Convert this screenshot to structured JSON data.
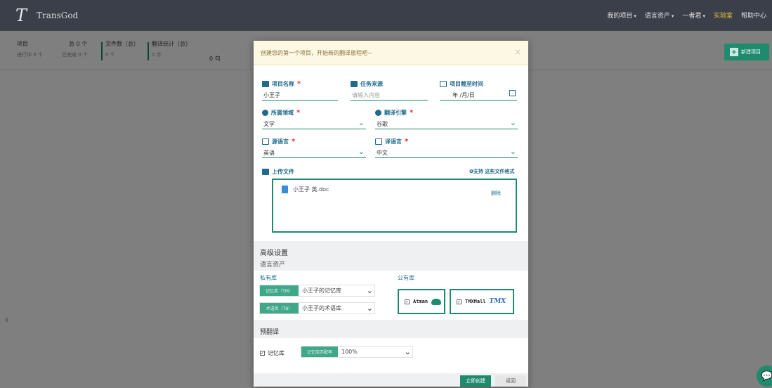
{
  "navbar": {
    "logo_glyph": "T",
    "brand": "TransGod",
    "menu": [
      "我的项目",
      "语言资产",
      "一者君",
      "实验室",
      "帮助中心"
    ]
  },
  "stats": {
    "project_label": "项目",
    "total": "总 0 个",
    "in_progress": "进行中 0 个",
    "completed": "已完成 0 个",
    "files_label": "文件数（总）",
    "files_sub": "0 个",
    "translation_label": "翻译统计（总）",
    "translation_sub": "0 字",
    "translation_val": "0 句",
    "new_project": "新建项目"
  },
  "modal": {
    "title": "创建您的第一个项目，开始新的翻译旅程吧~",
    "close": "×",
    "project_name": {
      "label": "项目名称",
      "value": "小王子"
    },
    "task_source": {
      "label": "任务来源",
      "placeholder": "请输入内容"
    },
    "deadline": {
      "label": "项目截至时间",
      "value": "年 /月/日"
    },
    "domain": {
      "label": "所属领域",
      "value": "文学"
    },
    "engine": {
      "label": "翻译引擎",
      "value": "谷歌"
    },
    "source_lang": {
      "label": "源语言",
      "value": "英语"
    },
    "target_lang": {
      "label": "译语言",
      "value": "中文"
    },
    "upload": {
      "label": "上传文件",
      "support": "❶支持 这些文件格式",
      "file_name": "小王子 英.doc",
      "delete": "删除"
    },
    "advanced": {
      "title": "高级设置",
      "subtitle": "语言资产",
      "private_label": "私有库",
      "public_label": "公有库",
      "tm_tag": "记忆库（TM）",
      "tm_value": "小王子的记忆库",
      "tb_tag": "术语库（TB）",
      "tb_value": "小王子的术语库",
      "lib1": "Atman",
      "lib2": "TMXMall",
      "lib2_logo": "TMX"
    },
    "pretrans": {
      "title": "预翻译",
      "checkbox_label": "记忆库",
      "match_tag": "记忆库匹配率",
      "match_value": "100%"
    },
    "create": "立即创建",
    "back": "返回"
  }
}
